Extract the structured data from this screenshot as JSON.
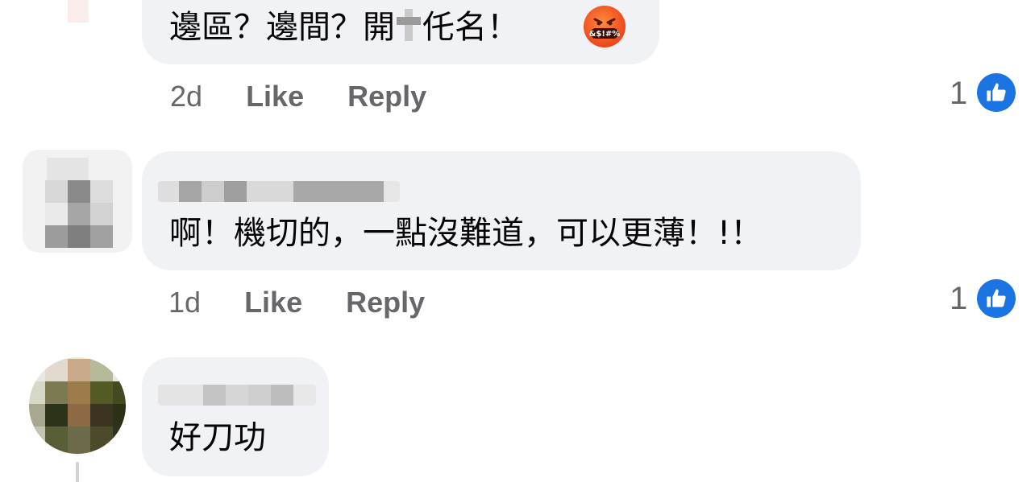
{
  "comments": [
    {
      "text_before": "邊區？邊間？開",
      "text_after": "仛名！",
      "emoji": "angry-symbols-emoji",
      "emoji_text": "&$!#%",
      "time": "2d",
      "like_label": "Like",
      "reply_label": "Reply",
      "reaction_count": "1"
    },
    {
      "text": "啊！機切的，一點沒難道，可以更薄！!！",
      "time": "1d",
      "like_label": "Like",
      "reply_label": "Reply",
      "reaction_count": "1"
    },
    {
      "text": "好刀功"
    }
  ],
  "colors": {
    "bubble": "#f0f2f5",
    "meta_text": "#65676b",
    "like_blue": "#1b74e4"
  },
  "icons": [
    "thumbs-up-icon",
    "angry-emoji"
  ]
}
